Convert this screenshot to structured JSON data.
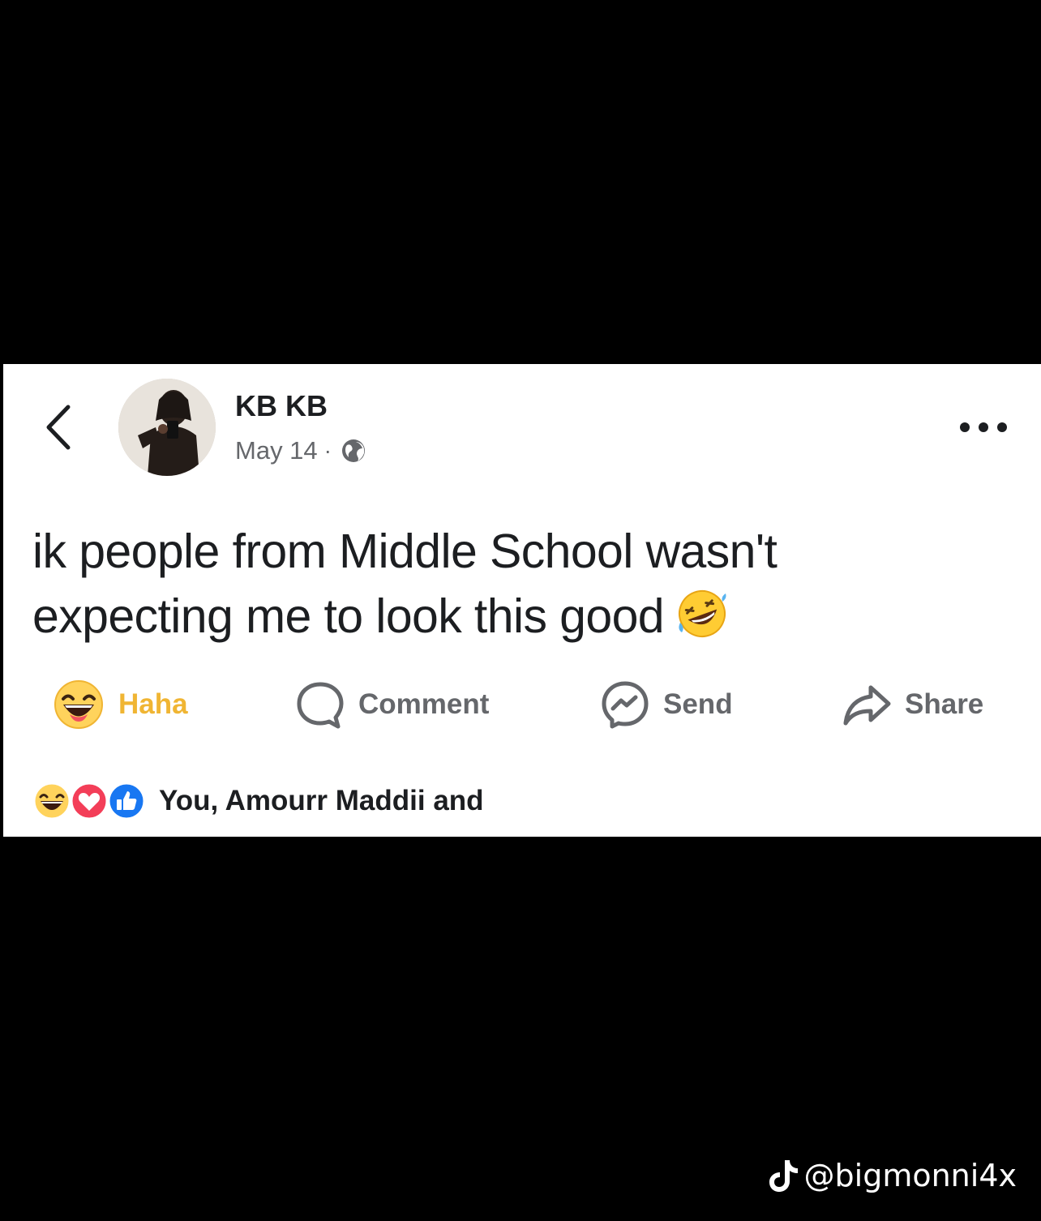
{
  "post": {
    "author": "KB KB",
    "date": "May 14",
    "separator": "·",
    "privacy_icon": "globe-icon",
    "text_line1": "ik people from Middle School wasn't",
    "text_line2": "expecting me to look this good",
    "emoji": "rolling-on-floor-laughing"
  },
  "actions": {
    "reaction_label": "Haha",
    "comment_label": "Comment",
    "send_label": "Send",
    "share_label": "Share"
  },
  "reactions": {
    "icons": [
      "haha-icon",
      "love-icon",
      "like-icon"
    ],
    "summary_text": "You, Amourr Maddii and"
  },
  "watermark": {
    "platform_icon": "tiktok-icon",
    "handle": "@bigmonni4x"
  },
  "colors": {
    "background": "#000000",
    "card": "#ffffff",
    "text_primary": "#1c1e21",
    "text_secondary": "#65676b",
    "haha": "#f0b533",
    "like": "#1877f2",
    "love": "#f33e58"
  }
}
